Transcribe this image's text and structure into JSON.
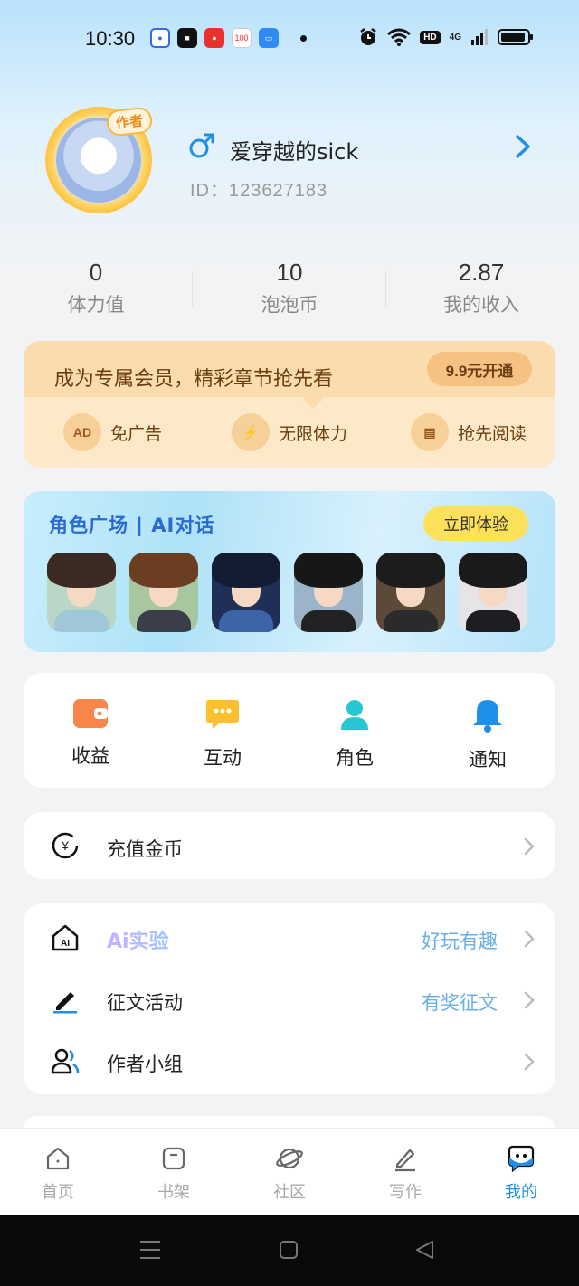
{
  "status_bar": {
    "time": "10:30",
    "network": "4G",
    "hd": "HD",
    "apps": [
      {
        "icon": "paw-app-icon",
        "color": "#2e6cf0",
        "text": "🐾"
      },
      {
        "icon": "news-app-icon",
        "color": "#111111",
        "text": "新"
      },
      {
        "icon": "red-packet-app-icon",
        "color": "#e8322d",
        "text": "¥"
      },
      {
        "icon": "score-app-icon",
        "color": "#f4f4f4",
        "text": "100"
      },
      {
        "icon": "blue-app-icon",
        "color": "#2f8af5",
        "text": ""
      }
    ]
  },
  "profile": {
    "author_tag": "作者",
    "nickname": "爱穿越的sick",
    "id_text": "ID：123627183"
  },
  "stats": [
    {
      "value": "0",
      "label": "体力值"
    },
    {
      "value": "10",
      "label": "泡泡币"
    },
    {
      "value": "2.87",
      "label": "我的收入"
    }
  ],
  "vip": {
    "title": "成为专属会员，精彩章节抢先看",
    "button": "9.9元开通",
    "perks": [
      {
        "icon_text": "AD",
        "label": "免广告"
      },
      {
        "icon_text": "⚡",
        "label": "无限体力"
      },
      {
        "icon_text": "▤",
        "label": "抢先阅读"
      }
    ]
  },
  "role_banner": {
    "title": "角色广场 | AI对话",
    "button": "立即体验",
    "avatars": [
      {
        "bg": "#b9d6c6",
        "hair": "#3b2a22",
        "body": "#9fc7d8"
      },
      {
        "bg": "#a8c7a1",
        "hair": "#6b3e22",
        "body": "#3a3d4a"
      },
      {
        "bg": "#1f2f55",
        "hair": "#141c33",
        "body": "#3d64a8"
      },
      {
        "bg": "#9bb4c9",
        "hair": "#171717",
        "body": "#222222"
      },
      {
        "bg": "#5b4a3a",
        "hair": "#1c1c1c",
        "body": "#2b2b2b"
      },
      {
        "bg": "#e7e4e8",
        "hair": "#1a1a1a",
        "body": "#1e1e22"
      }
    ]
  },
  "quick_actions": [
    {
      "icon": "wallet-icon",
      "label": "收益"
    },
    {
      "icon": "chat-bubble-icon",
      "label": "互动"
    },
    {
      "icon": "person-icon",
      "label": "角色"
    },
    {
      "icon": "bell-icon",
      "label": "通知"
    }
  ],
  "recharge": {
    "label": "充值金币"
  },
  "menu": {
    "ai_lab": {
      "label": "Ai实验",
      "extra": "好玩有趣"
    },
    "essay": {
      "label": "征文活动",
      "extra": "有奖征文"
    },
    "group": {
      "label": "作者小组"
    }
  },
  "bottom_nav": [
    {
      "icon": "home-icon",
      "label": "首页",
      "active": false
    },
    {
      "icon": "bookshelf-icon",
      "label": "书架",
      "active": false
    },
    {
      "icon": "planet-icon",
      "label": "社区",
      "active": false
    },
    {
      "icon": "pen-icon",
      "label": "写作",
      "active": false
    },
    {
      "icon": "mine-icon",
      "label": "我的",
      "active": true
    }
  ],
  "colors": {
    "accent": "#1f8fe8",
    "vip_bg": "#fde8c8",
    "role_btn": "#fde15a"
  }
}
